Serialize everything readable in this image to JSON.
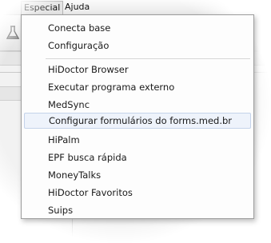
{
  "menubar": {
    "items": [
      {
        "label": "Especial"
      },
      {
        "label": "Ajuda"
      }
    ]
  },
  "menu": {
    "group1": [
      {
        "label": "Conecta base"
      },
      {
        "label": "Configuração"
      }
    ],
    "group2": [
      {
        "label": "HiDoctor Browser"
      },
      {
        "label": "Executar programa externo"
      },
      {
        "label": "MedSync"
      },
      {
        "label": "Configurar formulários do forms.med.br"
      },
      {
        "label": "HiPalm"
      },
      {
        "label": "EPF busca rápida"
      },
      {
        "label": "MoneyTalks"
      },
      {
        "label": "HiDoctor Favoritos"
      },
      {
        "label": "Suips"
      }
    ],
    "highlighted_item": "Configurar formulários do forms.med.br"
  },
  "colors": {
    "hover_bg": "#eef3fb",
    "hover_border": "#c4d3ea",
    "menu_border": "#9c9c9c"
  },
  "icons": [
    "flask-icon",
    "gear-icon"
  ]
}
